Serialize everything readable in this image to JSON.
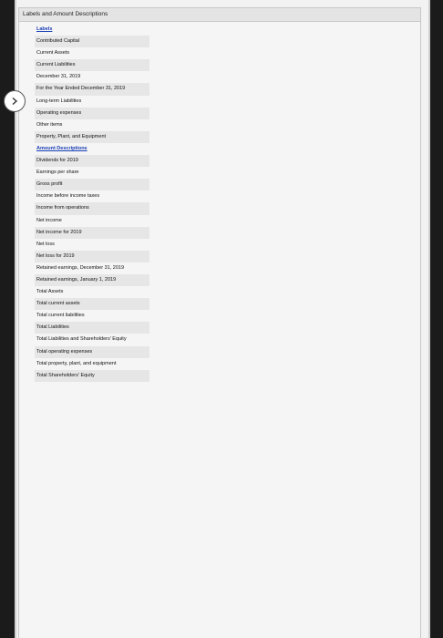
{
  "panel": {
    "title": "Labels and Amount Descriptions"
  },
  "labels_heading": "Labels",
  "labels": [
    "Contributed Capital",
    "Current Assets",
    "Current Liabilities",
    "December 31, 2019",
    "For the Year Ended December 31, 2019",
    "Long-term Liabilities",
    "Operating expenses",
    "Other items",
    "Property, Plant, and Equipment"
  ],
  "amounts_heading": "Amount Descriptions",
  "amounts": [
    "Dividends for 2019",
    "Earnings per share",
    "Gross profit",
    "Income before income taxes",
    "Income from operations",
    "Net income",
    "Net income for 2019",
    "Net loss",
    "Net loss for 2019",
    "Retained earnings, December 31, 2019",
    "Retained earnings, January 1, 2019",
    "Total Assets",
    "Total current assets",
    "Total current liabilities",
    "Total Liabilities",
    "Total Liabilities and Shareholders' Equity",
    "Total operating expenses",
    "Total property, plant, and equipment",
    "Total Shareholders' Equity"
  ],
  "colors": {
    "link_heading": "#1a3fb5",
    "alt_row": "#e6e6e6"
  },
  "icons": {
    "nav": "chevron-right-icon"
  }
}
